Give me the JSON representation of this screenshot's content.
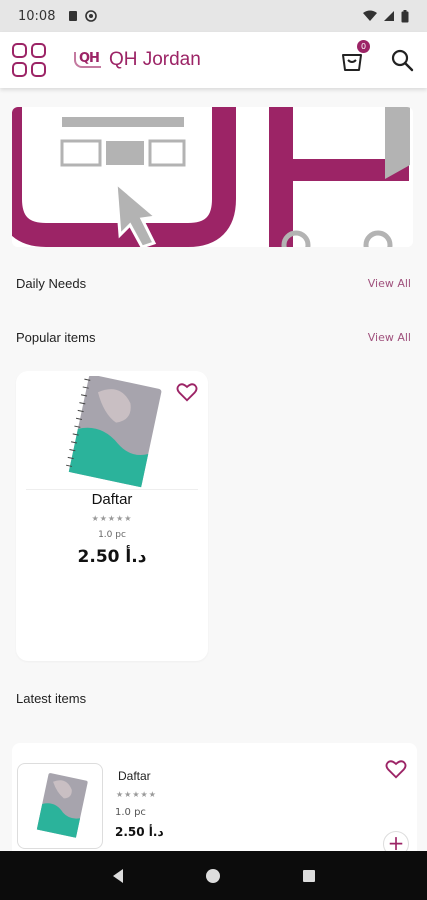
{
  "status_bar": {
    "time": "10:08"
  },
  "app_bar": {
    "logo_mark": "QH",
    "brand": "QH Jordan",
    "cart_count": "0"
  },
  "sections": {
    "daily_needs": {
      "title": "Daily Needs",
      "view_all": "View All"
    },
    "popular_items": {
      "title": "Popular items",
      "view_all": "View All"
    },
    "latest_items": {
      "title": "Latest items"
    }
  },
  "popular_products": [
    {
      "name": "Daftar",
      "stars": "★★★★★",
      "unit": "1.0 pc",
      "price": "2.50 د.أ"
    }
  ],
  "latest_products": [
    {
      "name": "Daftar",
      "stars": "★★★★★",
      "unit": "1.0 pc",
      "price": "2.50 د.أ"
    }
  ],
  "colors": {
    "accent": "#9c2466",
    "banner_gray": "#b3b3b3",
    "notebook_teal": "#2bb39b"
  },
  "icons": [
    "menu-grid-icon",
    "cart-icon",
    "search-icon",
    "heart-icon",
    "plus-icon",
    "back-icon",
    "home-icon",
    "recents-icon"
  ]
}
